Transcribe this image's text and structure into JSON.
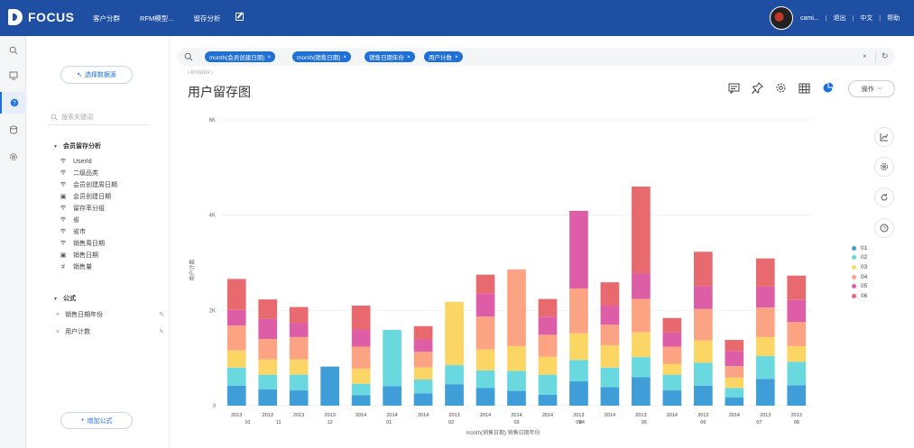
{
  "app": {
    "logo_text": "FOCUS",
    "nav": [
      "客户分群",
      "RFM模型...",
      "留存分析"
    ],
    "user_name": "cami...",
    "logout": "退出",
    "language": "中文",
    "help": "帮助"
  },
  "sidebar": {
    "select_datasource": "选择数据源",
    "search_placeholder": "搜索关键词",
    "group1_title": "会员留存分析",
    "fields": [
      {
        "icon": "T",
        "label": "UserId"
      },
      {
        "icon": "T",
        "label": "二级品类"
      },
      {
        "icon": "T",
        "label": "会员创建周日期"
      },
      {
        "icon": "cal",
        "label": "会员创建日期"
      },
      {
        "icon": "T",
        "label": "留存率分组"
      },
      {
        "icon": "T",
        "label": "省"
      },
      {
        "icon": "T",
        "label": "省市"
      },
      {
        "icon": "T",
        "label": "销售周日期"
      },
      {
        "icon": "cal",
        "label": "销售日期"
      },
      {
        "icon": "num",
        "label": "销售量"
      }
    ],
    "group2_title": "公式",
    "formulas": [
      "销售日期年份",
      "用户计数"
    ],
    "add_formula": "增加公式"
  },
  "query": {
    "chips": [
      "month(会员创建日期)",
      "month(销售日期)",
      "销售日期年份",
      "用户计数"
    ]
  },
  "main": {
    "answer_tag": "( ANSWER )",
    "title": "用户留存图",
    "ops_label": "操作"
  },
  "colors": {
    "brand": "#1f4fa3",
    "accent": "#1f6fd8"
  },
  "chart_data": {
    "type": "bar",
    "stacked": true,
    "ylabel": "用户计数",
    "xlabel": "month(销售日期)  销售日期年份",
    "ylim": [
      0,
      6000
    ],
    "yticks": [
      "0",
      "2K",
      "4K",
      "6K"
    ],
    "x_years": [
      "2013",
      "2013",
      "2013",
      "2013",
      "2014",
      "2014",
      "2014",
      "2013",
      "2014",
      "2014",
      "2014",
      "2013",
      "2014",
      "2013",
      "2014",
      "2013",
      "2014",
      "2013",
      "2013"
    ],
    "x_months": [
      "10",
      "11",
      "12",
      "01",
      "",
      "02",
      "",
      "03",
      "",
      "04",
      "",
      "05",
      "",
      "06",
      "",
      "07",
      "08",
      "09",
      ""
    ],
    "legend": [
      "01",
      "02",
      "03",
      "04",
      "05",
      "06"
    ],
    "colors": [
      "#3f9ed8",
      "#6ad9df",
      "#fcd665",
      "#fba383",
      "#dd5ea7",
      "#e86a6f"
    ],
    "series": [
      {
        "name": "01",
        "values": [
          420,
          340,
          320,
          820,
          220,
          410,
          260,
          450,
          370,
          310,
          230,
          510,
          390,
          600,
          320,
          420,
          170,
          560,
          430
        ]
      },
      {
        "name": "02",
        "values": [
          380,
          310,
          330,
          0,
          240,
          1180,
          290,
          400,
          370,
          420,
          420,
          450,
          410,
          420,
          330,
          480,
          200,
          480,
          490
        ]
      },
      {
        "name": "03",
        "values": [
          360,
          320,
          320,
          0,
          320,
          0,
          250,
          1330,
          440,
          520,
          380,
          560,
          470,
          520,
          230,
          470,
          220,
          400,
          330
        ]
      },
      {
        "name": "04",
        "values": [
          520,
          430,
          470,
          0,
          460,
          0,
          330,
          0,
          690,
          1610,
          460,
          940,
          430,
          700,
          360,
          660,
          240,
          620,
          510
        ]
      },
      {
        "name": "05",
        "values": [
          330,
          420,
          300,
          0,
          360,
          0,
          260,
          0,
          490,
          0,
          380,
          1630,
          400,
          540,
          300,
          480,
          320,
          440,
          460
        ]
      },
      {
        "name": "06",
        "values": [
          650,
          410,
          330,
          0,
          500,
          0,
          280,
          0,
          390,
          0,
          370,
          0,
          490,
          1820,
          300,
          720,
          230,
          590,
          510
        ]
      }
    ]
  }
}
